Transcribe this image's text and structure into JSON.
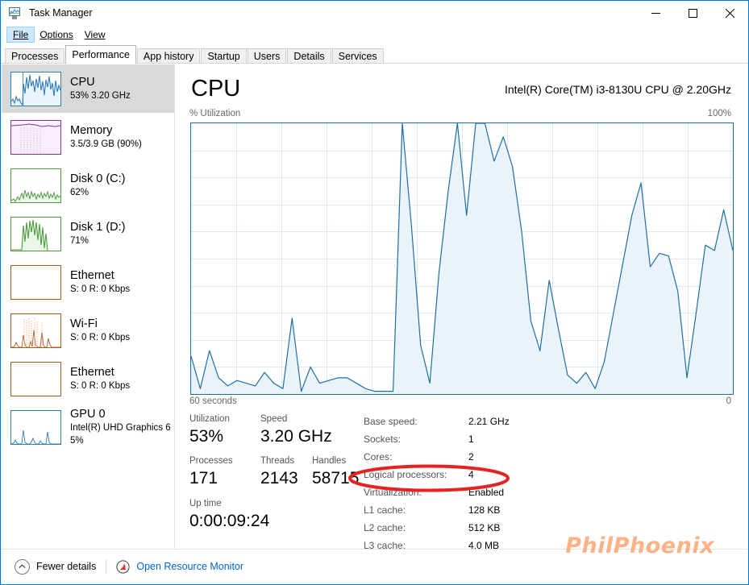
{
  "window": {
    "title": "Task Manager",
    "icon": "task-manager-icon",
    "buttons": {
      "minimize": "minimize-icon",
      "maximize": "maximize-icon",
      "close": "close-icon"
    }
  },
  "menu": {
    "items": [
      "File",
      "Options",
      "View"
    ],
    "active_index": 0
  },
  "tabs": {
    "items": [
      "Processes",
      "Performance",
      "App history",
      "Startup",
      "Users",
      "Details",
      "Services"
    ],
    "selected": "Performance"
  },
  "sidebar": {
    "items": [
      {
        "title": "CPU",
        "sub": "53%  3.20 GHz",
        "sub2": "",
        "selected": true,
        "color": "#4a90c4",
        "thumb": "cpu-thumbnail"
      },
      {
        "title": "Memory",
        "sub": "3.5/3.9 GB (90%)",
        "sub2": "",
        "selected": false,
        "color": "#8b2fa3",
        "thumb": "memory-thumbnail"
      },
      {
        "title": "Disk 0 (C:)",
        "sub": "62%",
        "sub2": "",
        "selected": false,
        "color": "#4f9a41",
        "thumb": "disk0-thumbnail"
      },
      {
        "title": "Disk 1 (D:)",
        "sub": "71%",
        "sub2": "",
        "selected": false,
        "color": "#4f9a41",
        "thumb": "disk1-thumbnail"
      },
      {
        "title": "Ethernet",
        "sub_prefix_s": "S:",
        "sub_s": "0",
        "sub_prefix_r": "R:",
        "sub_r": "0 Kbps",
        "sub": "S: 0 R: 0 Kbps",
        "sub2": "",
        "selected": false,
        "color": "#b05a1e",
        "thumb": "ethernet-thumbnail"
      },
      {
        "title": "Wi-Fi",
        "sub": "S: 0 R: 0 Kbps",
        "sub2": "",
        "selected": false,
        "color": "#b05a1e",
        "thumb": "wifi-thumbnail"
      },
      {
        "title": "Ethernet",
        "sub": "S: 0 R: 0 Kbps",
        "sub2": "",
        "selected": false,
        "color": "#b05a1e",
        "thumb": "ethernet2-thumbnail"
      },
      {
        "title": "GPU 0",
        "sub": "Intel(R) UHD Graphics 6",
        "sub2": "5%",
        "selected": false,
        "color": "#2e7cb8",
        "thumb": "gpu0-thumbnail"
      }
    ]
  },
  "main": {
    "heading": "CPU",
    "model": "Intel(R) Core(TM) i3-8130U CPU @ 2.20GHz",
    "axis_top_left": "% Utilization",
    "axis_top_right": "100%",
    "axis_bottom_left": "60 seconds",
    "axis_bottom_right": "0",
    "stats": {
      "utilization": {
        "label": "Utilization",
        "value": "53%"
      },
      "speed": {
        "label": "Speed",
        "value": "3.20 GHz"
      },
      "processes": {
        "label": "Processes",
        "value": "171"
      },
      "threads": {
        "label": "Threads",
        "value": "2143"
      },
      "handles": {
        "label": "Handles",
        "value": "58715"
      },
      "uptime": {
        "label": "Up time",
        "value": "0:00:09:24"
      }
    },
    "details": [
      {
        "key": "Base speed:",
        "value": "2.21 GHz"
      },
      {
        "key": "Sockets:",
        "value": "1"
      },
      {
        "key": "Cores:",
        "value": "2"
      },
      {
        "key": "Logical processors:",
        "value": "4"
      },
      {
        "key": "Virtualization:",
        "value": "Enabled",
        "highlighted": true
      },
      {
        "key": "L1 cache:",
        "value": "128 KB"
      },
      {
        "key": "L2 cache:",
        "value": "512 KB"
      },
      {
        "key": "L3 cache:",
        "value": "4.0 MB"
      }
    ],
    "annotation": {
      "shape": "ellipse",
      "color": "#e52421",
      "targets": "Virtualization: Enabled"
    }
  },
  "statusbar": {
    "fewer_details": "Fewer details",
    "open_resource_monitor": "Open Resource Monitor",
    "chevron_icon": "chevron-up-circle-icon",
    "resmon_icon": "resource-monitor-icon",
    "link_color": "#0066cc"
  },
  "watermark": {
    "text": "PhilPhoenix",
    "color": "#fbb287"
  },
  "chart_data": {
    "type": "area",
    "title": "% Utilization",
    "xlabel": "",
    "ylabel": "% Utilization",
    "x_axis_left_label": "60 seconds",
    "x_axis_right_label": "0",
    "ylim": [
      0,
      100
    ],
    "grid": true,
    "grid_rows": 10,
    "grid_cols": 12,
    "line_color": "#1f6fa5",
    "fill_color": "#eaf3fa",
    "series": [
      {
        "name": "CPU Utilization",
        "values": [
          14,
          2,
          16,
          6,
          3,
          5,
          4,
          3,
          8,
          4,
          2,
          28,
          1,
          10,
          4,
          5,
          6,
          6,
          4,
          2,
          1,
          1,
          1,
          100,
          62,
          18,
          4,
          45,
          75,
          100,
          66,
          100,
          100,
          86,
          95,
          84,
          60,
          27,
          16,
          42,
          24,
          7,
          4,
          8,
          2,
          12,
          30,
          48,
          66,
          78,
          47,
          52,
          51,
          38,
          6,
          30,
          55,
          53,
          68,
          53
        ]
      }
    ]
  }
}
